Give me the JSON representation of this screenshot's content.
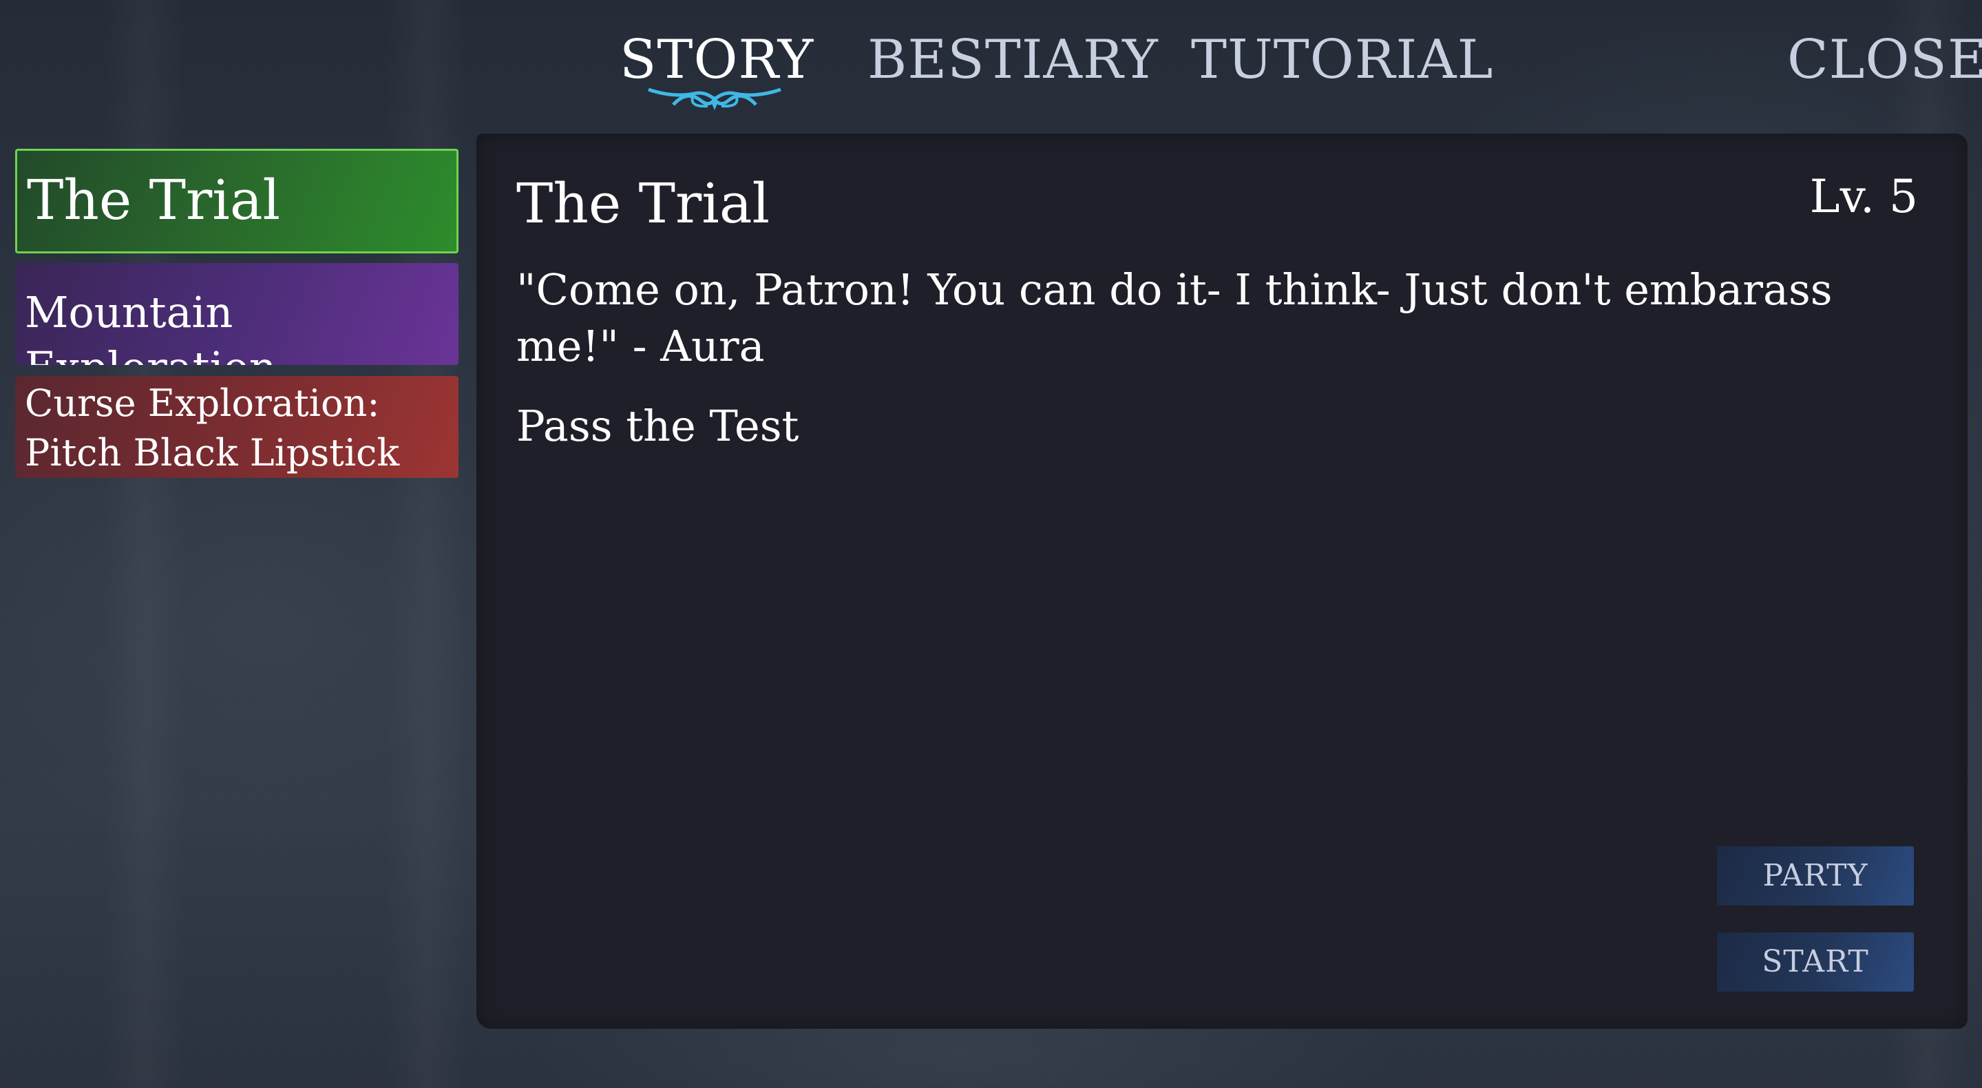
{
  "nav": {
    "tabs": [
      {
        "label": "STORY",
        "active": true
      },
      {
        "label": "BESTIARY",
        "active": false
      },
      {
        "label": "TUTORIAL",
        "active": false
      }
    ],
    "close_label": "CLOSE",
    "active_ornament_color": "#3fb8e6"
  },
  "quests": [
    {
      "title": "The Trial",
      "color": "#2a7a2c",
      "border": "#6fd350",
      "selected": true
    },
    {
      "title": "Mountain Exploration",
      "color": "#5a3088",
      "selected": false
    },
    {
      "title": "Curse Exploration: Pitch Black Lipstick",
      "color": "#8a3032",
      "selected": false
    }
  ],
  "detail": {
    "title": "The Trial",
    "level": "Lv. 5",
    "quote": "\"Come on, Patron! You can do it- I think- Just don't embarass me!\" - Aura",
    "objective": "Pass the Test"
  },
  "actions": {
    "party_label": "PARTY",
    "start_label": "START"
  }
}
